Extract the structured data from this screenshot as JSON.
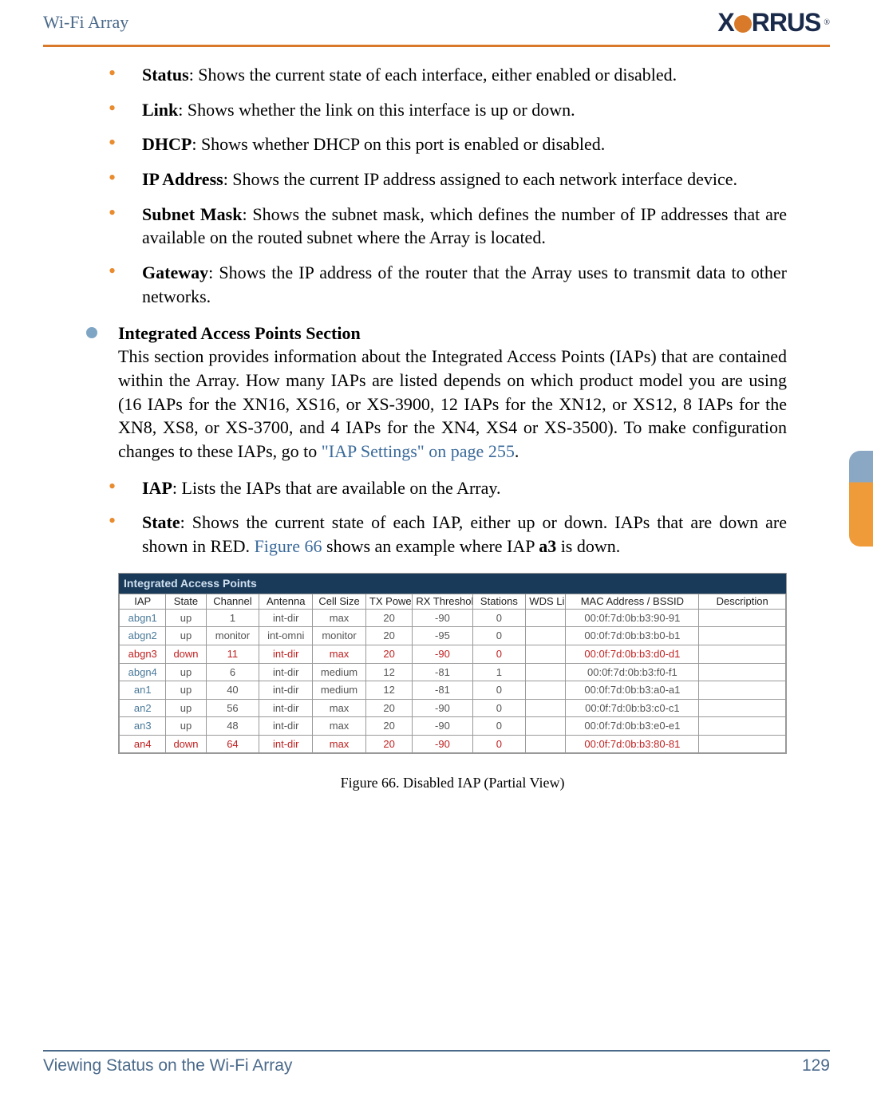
{
  "header": {
    "title": "Wi-Fi Array",
    "logo_x": "X",
    "logo_rest": "RRUS",
    "logo_reg": "®"
  },
  "defs": {
    "status": {
      "term": "Status",
      "text": ": Shows the current state of each interface, either enabled or disabled."
    },
    "link": {
      "term": "Link",
      "text": ": Shows whether the link on this interface is up or down."
    },
    "dhcp": {
      "term": "DHCP",
      "text": ": Shows whether DHCP on this port is enabled or disabled."
    },
    "ip": {
      "term": "IP Address",
      "text": ": Shows the current IP address assigned to each network interface device."
    },
    "subnet": {
      "term": "Subnet Mask",
      "text": ": Shows the subnet mask, which defines the number of IP addresses that are available on the routed subnet where the Array is located."
    },
    "gateway": {
      "term": "Gateway",
      "text": ": Shows the IP address of the router that the Array uses to transmit data to other networks."
    }
  },
  "section": {
    "title": "Integrated Access Points Section",
    "body_a": "This section provides information about the Integrated Access Points (IAPs) that are contained within the Array. How many IAPs are listed depends on which product model you are using (16 IAPs for the XN16, XS16, or XS-3900, 12 IAPs for the XN12, or XS12, 8 IAPs for the XN8, XS8, or XS-3700, and 4 IAPs for the XN4, XS4 or XS-3500). To make configuration changes to these IAPs, go to ",
    "link": "\"IAP Settings\" on page 255",
    "body_b": "."
  },
  "defs2": {
    "iap": {
      "term": "IAP",
      "text": ": Lists the IAPs that are available on the Array."
    },
    "state": {
      "term": "State",
      "text_a": ": Shows the current state of each IAP, either up or down. IAPs that are down are shown in RED. ",
      "link": "Figure 66",
      "text_b": " shows an example where IAP ",
      "bold": "a3",
      "text_c": " is down."
    }
  },
  "chart_data": {
    "type": "table",
    "title": "Integrated Access Points",
    "columns": [
      "IAP",
      "State",
      "Channel",
      "Antenna",
      "Cell Size",
      "TX Power",
      "RX Threshold",
      "Stations",
      "WDS Link",
      "MAC Address / BSSID",
      "Description"
    ],
    "rows": [
      {
        "iap": "abgn1",
        "state": "up",
        "channel": "1",
        "antenna": "int-dir",
        "cell": "max",
        "tx": "20",
        "rx": "-90",
        "stations": "0",
        "wds": "",
        "mac": "00:0f:7d:0b:b3:90-91",
        "desc": "",
        "down": false
      },
      {
        "iap": "abgn2",
        "state": "up",
        "channel": "monitor",
        "antenna": "int-omni",
        "cell": "monitor",
        "tx": "20",
        "rx": "-95",
        "stations": "0",
        "wds": "",
        "mac": "00:0f:7d:0b:b3:b0-b1",
        "desc": "",
        "down": false
      },
      {
        "iap": "abgn3",
        "state": "down",
        "channel": "11",
        "antenna": "int-dir",
        "cell": "max",
        "tx": "20",
        "rx": "-90",
        "stations": "0",
        "wds": "",
        "mac": "00:0f:7d:0b:b3:d0-d1",
        "desc": "",
        "down": true
      },
      {
        "iap": "abgn4",
        "state": "up",
        "channel": "6",
        "antenna": "int-dir",
        "cell": "medium",
        "tx": "12",
        "rx": "-81",
        "stations": "1",
        "wds": "",
        "mac": "00:0f:7d:0b:b3:f0-f1",
        "desc": "",
        "down": false
      },
      {
        "iap": "an1",
        "state": "up",
        "channel": "40",
        "antenna": "int-dir",
        "cell": "medium",
        "tx": "12",
        "rx": "-81",
        "stations": "0",
        "wds": "",
        "mac": "00:0f:7d:0b:b3:a0-a1",
        "desc": "",
        "down": false
      },
      {
        "iap": "an2",
        "state": "up",
        "channel": "56",
        "antenna": "int-dir",
        "cell": "max",
        "tx": "20",
        "rx": "-90",
        "stations": "0",
        "wds": "",
        "mac": "00:0f:7d:0b:b3:c0-c1",
        "desc": "",
        "down": false
      },
      {
        "iap": "an3",
        "state": "up",
        "channel": "48",
        "antenna": "int-dir",
        "cell": "max",
        "tx": "20",
        "rx": "-90",
        "stations": "0",
        "wds": "",
        "mac": "00:0f:7d:0b:b3:e0-e1",
        "desc": "",
        "down": false
      },
      {
        "iap": "an4",
        "state": "down",
        "channel": "64",
        "antenna": "int-dir",
        "cell": "max",
        "tx": "20",
        "rx": "-90",
        "stations": "0",
        "wds": "",
        "mac": "00:0f:7d:0b:b3:80-81",
        "desc": "",
        "down": true
      }
    ]
  },
  "figure_caption": "Figure 66. Disabled IAP (Partial View)",
  "footer": {
    "text": "Viewing Status on the Wi-Fi Array",
    "page": "129"
  }
}
